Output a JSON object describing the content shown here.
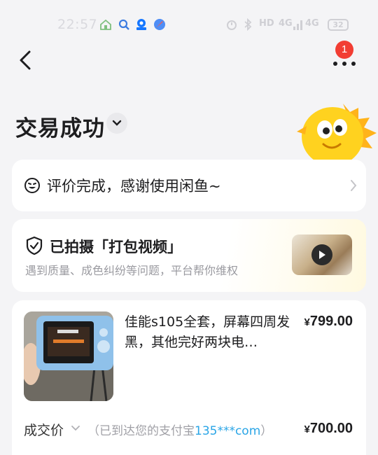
{
  "status_bar": {
    "time": "22:57",
    "signal_a": "4G",
    "signal_b": "4G",
    "wifi_label": "HD",
    "battery": "32",
    "apps": [
      "home-app-icon",
      "search-app-icon",
      "alipay-app-icon",
      "browser-app-icon"
    ]
  },
  "nav": {
    "more_badge": "1"
  },
  "page": {
    "title": "交易成功"
  },
  "review": {
    "text": "评价完成，感谢使用闲鱼~"
  },
  "video": {
    "title": "已拍摄「打包视频」",
    "subtitle": "遇到质量、成色纠纷等问题，平台帮你维权"
  },
  "product": {
    "name": "佳能s105全套，屏幕四周发黑，其他完好两块电…",
    "currency": "¥",
    "price": "799.00"
  },
  "deal": {
    "label": "成交价",
    "note_prefix": "（已到达您的支付宝",
    "account": "135***com",
    "note_suffix": "）",
    "currency": "¥",
    "price": "700.00"
  },
  "colors": {
    "accent_blue": "#2aa5e6",
    "badge_red": "#f23d33",
    "mascot_yellow": "#ffd21f"
  }
}
